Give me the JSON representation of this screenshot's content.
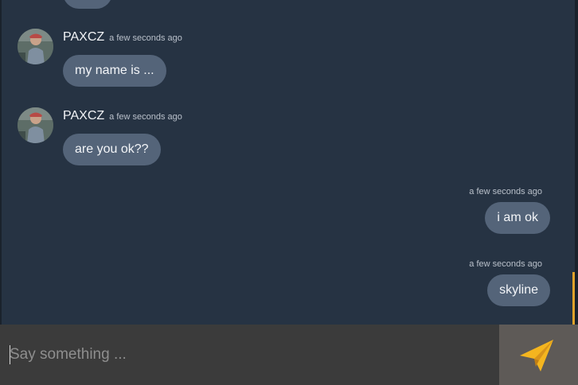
{
  "messages": [
    {
      "direction": "incoming",
      "author": "PAXCZ",
      "time": "a few seconds ago",
      "text": "my name is ..."
    },
    {
      "direction": "incoming",
      "author": "PAXCZ",
      "time": "a few seconds ago",
      "text": "are you ok??"
    },
    {
      "direction": "outgoing",
      "time": "a few seconds ago",
      "text": "i am ok"
    },
    {
      "direction": "outgoing",
      "time": "a few seconds ago",
      "text": "skyline"
    }
  ],
  "composer": {
    "value": "",
    "placeholder": "Say something ...",
    "send_icon": "paper-plane-icon"
  },
  "colors": {
    "background": "#263343",
    "bubble": "#546479",
    "composer": "#3b3b3b",
    "send_button": "#5e5a57",
    "scroll_accent": "#e0a22a",
    "plane": "#f4b51f"
  }
}
